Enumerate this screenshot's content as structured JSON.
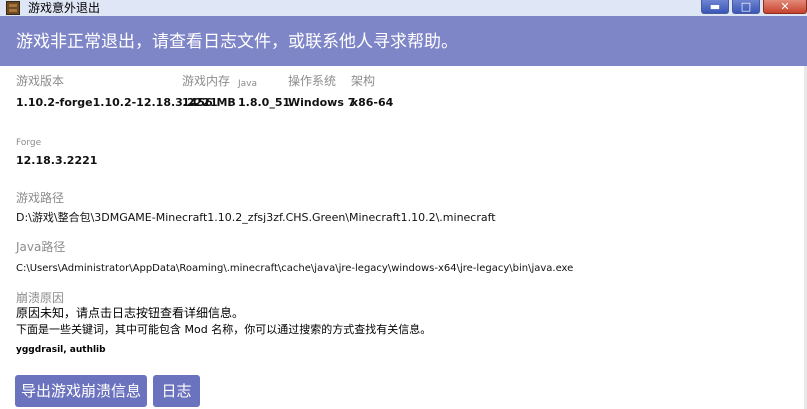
{
  "window": {
    "title": "游戏意外退出",
    "btn_minimize": "▬",
    "btn_maximize": "□",
    "btn_close": "✕"
  },
  "banner": "游戏非正常退出，请查看日志文件，或联系他人寻求帮助。",
  "info": {
    "version_label": "游戏版本",
    "version_value": "1.10.2-forge1.10.2-12.18.3.2221",
    "memory_label": "游戏内存",
    "memory_value": "1456 MB",
    "java_label": "Java",
    "java_value": "1.8.0_51",
    "os_label": "操作系统",
    "os_value": "Windows 7",
    "arch_label": "架构",
    "arch_value": "x86-64"
  },
  "forge": {
    "label": "Forge",
    "value": "12.18.3.2221"
  },
  "game_path": {
    "label": "游戏路径",
    "value": "D:\\游戏\\整合包\\3DMGAME-Minecraft1.10.2_zfsj3zf.CHS.Green\\Minecraft1.10.2\\.minecraft"
  },
  "java_path": {
    "label": "Java路径",
    "value": "C:\\Users\\Administrator\\AppData\\Roaming\\.minecraft\\cache\\java\\jre-legacy\\windows-x64\\jre-legacy\\bin\\java.exe"
  },
  "crash": {
    "label": "崩溃原因",
    "line1": "原因未知，请点击日志按钮查看详细信息。",
    "line2": "下面是一些关键词，其中可能包含 Mod 名称，你可以通过搜索的方式查找有关信息。",
    "keywords": "yggdrasil, authlib"
  },
  "buttons": {
    "export": "导出游戏崩溃信息",
    "log": "日志"
  }
}
